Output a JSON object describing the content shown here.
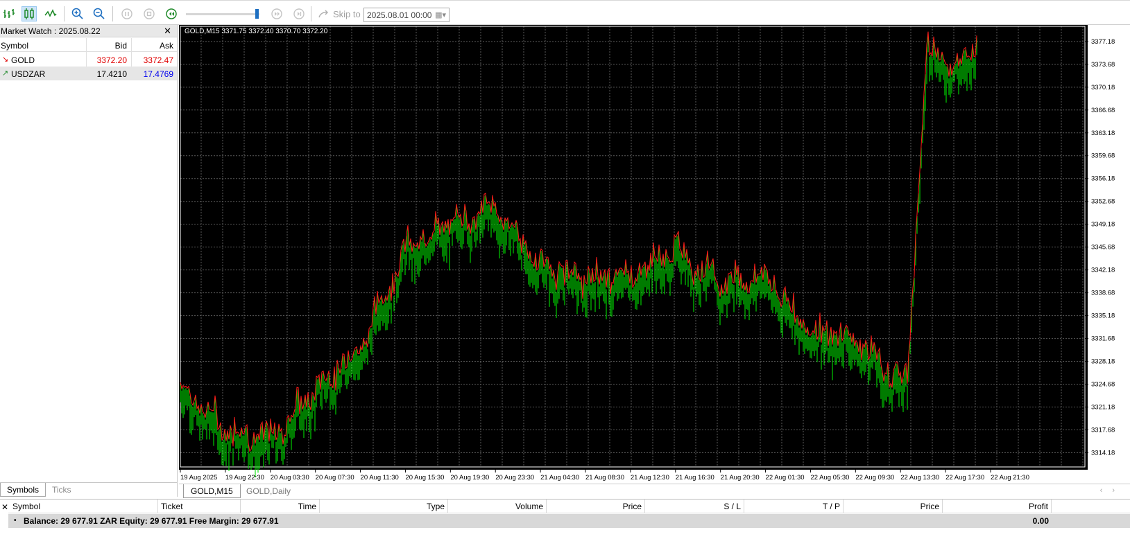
{
  "toolbar": {
    "skip_label": "Skip to",
    "skip_date": "2025.08.01 00:00"
  },
  "market_watch": {
    "title": "Market Watch : 2025.08.22",
    "columns": {
      "symbol": "Symbol",
      "bid": "Bid",
      "ask": "Ask"
    },
    "rows": [
      {
        "symbol": "GOLD",
        "bid": "3372.20",
        "ask": "3372.47",
        "direction": "down",
        "bid_color": "#e00000",
        "ask_color": "#e00000"
      },
      {
        "symbol": "USDZAR",
        "bid": "17.4210",
        "ask": "17.4769",
        "direction": "up",
        "bid_color": "#000000",
        "ask_color": "#0000ee"
      }
    ],
    "tabs": [
      "Symbols",
      "Ticks"
    ]
  },
  "chart": {
    "header": "GOLD,M15  3371.75 3372.40 3370.70 3372.20",
    "price_labels": [
      "3377.18",
      "3373.68",
      "3370.18",
      "3366.68",
      "3363.18",
      "3359.68",
      "3356.18",
      "3352.68",
      "3349.18",
      "3345.68",
      "3342.18",
      "3338.68",
      "3335.18",
      "3331.68",
      "3328.18",
      "3324.68",
      "3321.18",
      "3317.68",
      "3314.18"
    ],
    "time_labels": [
      "19 Aug 2025",
      "19 Aug 22:30",
      "20 Aug 03:30",
      "20 Aug 07:30",
      "20 Aug 11:30",
      "20 Aug 15:30",
      "20 Aug 19:30",
      "20 Aug 23:30",
      "21 Aug 04:30",
      "21 Aug 08:30",
      "21 Aug 12:30",
      "21 Aug 16:30",
      "21 Aug 20:30",
      "22 Aug 01:30",
      "22 Aug 05:30",
      "22 Aug 09:30",
      "22 Aug 13:30",
      "22 Aug 17:30",
      "22 Aug 21:30"
    ],
    "tabs": [
      "GOLD,M15",
      "GOLD,Daily"
    ],
    "colors": {
      "background": "#000000",
      "grid": "#5a5a5a",
      "candles": "#00e000",
      "ask_line": "#ff1a1a"
    }
  },
  "chart_data": {
    "type": "line",
    "title": "GOLD,M15",
    "x": [
      "19 Aug 2025",
      "19 Aug 22:30",
      "20 Aug 03:30",
      "20 Aug 07:30",
      "20 Aug 11:30",
      "20 Aug 15:30",
      "20 Aug 19:30",
      "20 Aug 23:30",
      "21 Aug 04:30",
      "21 Aug 08:30",
      "21 Aug 12:30",
      "21 Aug 16:30",
      "21 Aug 20:30",
      "22 Aug 01:30",
      "22 Aug 05:30",
      "22 Aug 09:30",
      "22 Aug 13:30",
      "22 Aug 17:30",
      "22 Aug 21:30"
    ],
    "series": [
      {
        "name": "GOLD",
        "values": [
          3322.5,
          3316.0,
          3314.5,
          3322.0,
          3328.5,
          3343.5,
          3347.5,
          3350.0,
          3341.0,
          3339.0,
          3339.5,
          3343.5,
          3338.5,
          3339.5,
          3331.0,
          3330.0,
          3323.0,
          3373.0,
          3372.2
        ]
      }
    ],
    "ylim": [
      3312.0,
      3379.5
    ],
    "grid": true
  },
  "toolbox": {
    "columns": [
      "Symbol",
      "Ticket",
      "Time",
      "Type",
      "Volume",
      "Price",
      "S / L",
      "T / P",
      "Price",
      "Profit"
    ],
    "balance_text": "Balance: 29 677.91 ZAR  Equity: 29 677.91  Free Margin: 29 677.91",
    "profit": "0.00"
  }
}
